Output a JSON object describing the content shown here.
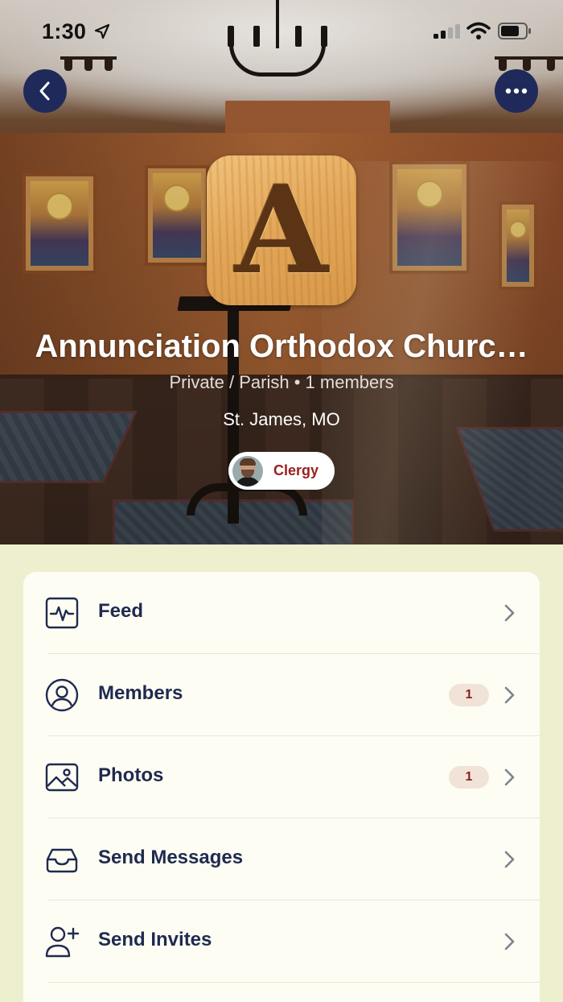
{
  "status_bar": {
    "time": "1:30"
  },
  "group": {
    "logo_letter": "A",
    "name": "Annunciation Orthodox Churc…",
    "meta": "Private / Parish • 1 members",
    "location": "St. James, MO",
    "role": "Clergy"
  },
  "menu": {
    "items": [
      {
        "label": "Feed",
        "icon": "activity-icon",
        "badge": ""
      },
      {
        "label": "Members",
        "icon": "user-circle-icon",
        "badge": "1"
      },
      {
        "label": "Photos",
        "icon": "photo-icon",
        "badge": "1"
      },
      {
        "label": "Send Messages",
        "icon": "inbox-icon",
        "badge": ""
      },
      {
        "label": "Send Invites",
        "icon": "user-plus-icon",
        "badge": ""
      }
    ]
  },
  "colors": {
    "accent_navy": "#1f2a5a",
    "badge_bg": "#f1e3d8",
    "badge_text": "#8d1d1d",
    "page_bg": "#eeefcf"
  }
}
